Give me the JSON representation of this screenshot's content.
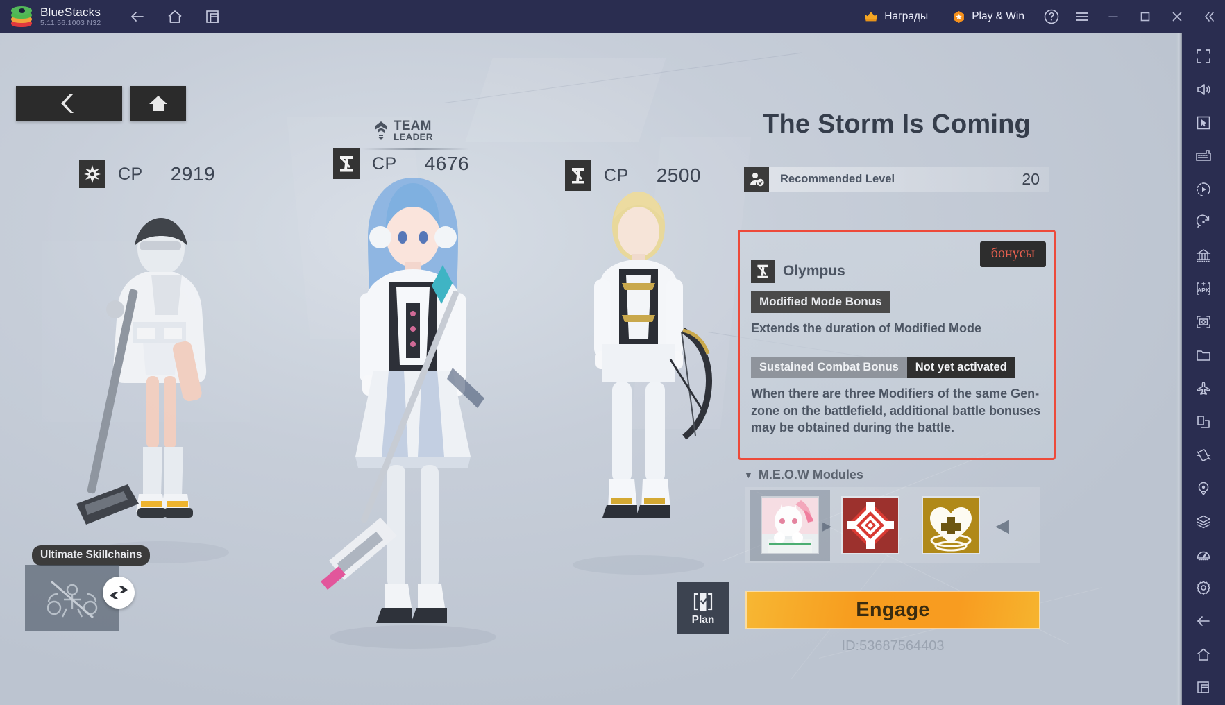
{
  "window": {
    "app_name": "BlueStacks",
    "version": "5.11.56.1003  N32",
    "nav": [
      {
        "name": "back-icon",
        "label": "Back"
      },
      {
        "name": "home-icon",
        "label": "Home"
      },
      {
        "name": "multi-instance-icon",
        "label": "Multi-instance"
      }
    ],
    "rewards_label": "Награды",
    "playwin_label": "Play & Win",
    "help_label": "?",
    "menu_label": "Menu",
    "minimize_label": "Minimize",
    "maximize_label": "Maximize",
    "close_label": "Close",
    "collapse_label": "Collapse"
  },
  "sidebar": {
    "items": [
      {
        "name": "fullscreen-icon",
        "label": "Full screen"
      },
      {
        "name": "volume-icon",
        "label": "Volume"
      },
      {
        "name": "cursor-controls-icon",
        "label": "Game controls"
      },
      {
        "name": "keyboard-icon",
        "label": "Keymapping"
      },
      {
        "name": "macro-recorder-icon",
        "label": "Macro recorder"
      },
      {
        "name": "rotate-icon",
        "label": "Rotate"
      },
      {
        "name": "multi-instance-manager-icon",
        "label": "Instance manager"
      },
      {
        "name": "install-apk-icon",
        "label": "Install APK"
      },
      {
        "name": "screenshot-icon",
        "label": "Screenshot"
      },
      {
        "name": "media-manager-icon",
        "label": "Media manager"
      },
      {
        "name": "airplane-icon",
        "label": "Eco mode"
      },
      {
        "name": "multi-window-icon",
        "label": "Multi window"
      },
      {
        "name": "shake-icon",
        "label": "Shake"
      },
      {
        "name": "location-icon",
        "label": "Location"
      },
      {
        "name": "layers-icon",
        "label": "Layers"
      },
      {
        "name": "performance-icon",
        "label": "Performance"
      },
      {
        "name": "settings-icon",
        "label": "Settings"
      },
      {
        "name": "back-icon",
        "label": "Back"
      },
      {
        "name": "home-icon",
        "label": "Home"
      },
      {
        "name": "recents-icon",
        "label": "Recents"
      }
    ]
  },
  "game": {
    "back_button_label": "Back",
    "home_button_label": "Home",
    "team_leader": {
      "line1": "TEAM",
      "line2": "LEADER"
    },
    "units": [
      {
        "slot": 1,
        "cp_label": "CP",
        "cp_value": "2919",
        "icon": "star-class-icon"
      },
      {
        "slot": 2,
        "cp_label": "CP",
        "cp_value": "4676",
        "icon": "olympus-class-icon",
        "is_leader": true
      },
      {
        "slot": 3,
        "cp_label": "CP",
        "cp_value": "2500",
        "icon": "olympus-class-icon"
      }
    ],
    "ultimate_skillchains": {
      "tooltip": "Ultimate Skillchains",
      "swap_label": "Swap"
    },
    "mission": {
      "title": "The Storm Is Coming",
      "recommended_level_label": "Recommended Level",
      "recommended_level_value": "20"
    },
    "bonus_panel": {
      "highlight_color": "#ed4a3a",
      "tag_label": "бонусы",
      "tag_text_color": "#e8604f",
      "faction_name": "Olympus",
      "bonus_1": {
        "chip": "Modified Mode Bonus",
        "description": "Extends the duration of Modified Mode"
      },
      "bonus_2": {
        "chip": "Sustained Combat Bonus",
        "status": "Not yet activated",
        "description": "When there are three Modifiers of the same Gen-zone on the battlefield, additional battle bonuses may be obtained during the battle."
      }
    },
    "meow_modules": {
      "header": "M.E.O.W Modules",
      "caret": "▼",
      "slots": [
        {
          "name": "module-slot-character-portrait",
          "selected": true
        },
        {
          "name": "module-slot-red-emblem",
          "selected": false
        },
        {
          "name": "module-slot-gold-heart",
          "selected": false
        }
      ],
      "scroll_arrow": "◀"
    },
    "plan_button_label": "Plan",
    "engage_button_label": "Engage",
    "account_id": "ID:53687564403"
  }
}
